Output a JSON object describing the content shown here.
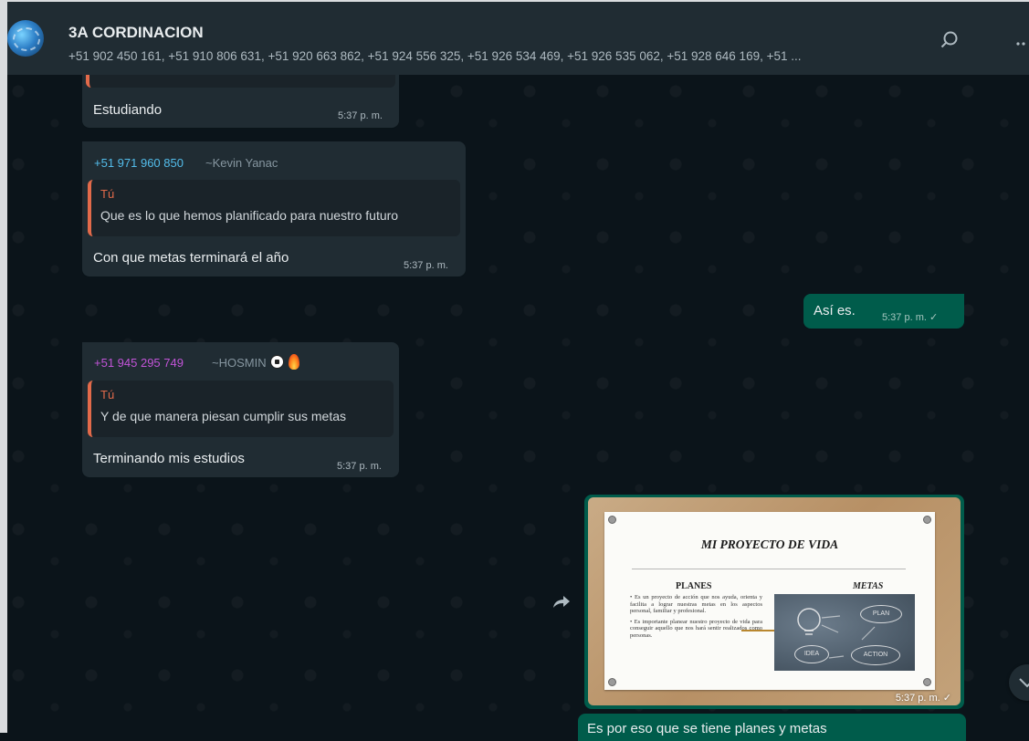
{
  "header": {
    "title": "3A CORDINACION",
    "members": "+51 902 450 161, +51 910 806 631, +51 920 663 862, +51 924 556 325, +51 926 534 469, +51 926 535 062, +51 928 646 169, +51 ...",
    "icons": [
      "search-icon",
      "menu-icon"
    ]
  },
  "messages": [
    {
      "direction": "in",
      "text": "Estudiando",
      "time": "5:37 p. m."
    },
    {
      "direction": "in",
      "sender_phone": "+51 971 960 850",
      "sender_name": "~Kevin Yanac",
      "sender_color": "#53bdeb",
      "quote_author": "Tú",
      "quote_text": "Que es lo que hemos planificado para nuestro futuro",
      "text": "Con que metas terminará el año",
      "time": "5:37 p. m."
    },
    {
      "direction": "out",
      "text": "Así es.",
      "time": "5:37 p. m. ✓"
    },
    {
      "direction": "in",
      "sender_phone": "+51 945 295 749",
      "sender_name": "~HOSMIN",
      "sender_color": "#c254d8",
      "quote_author": "Tú",
      "quote_text": "Y de que manera piesan cumplir sus metas",
      "text": "Terminando mis estudios",
      "time": "5:37 p. m."
    },
    {
      "direction": "out",
      "type": "image",
      "time": "5:37 p. m. ✓",
      "slide": {
        "title": "MI PROYECTO DE VIDA",
        "planes_heading": "PLANES",
        "metas_heading": "METAS",
        "planes_bullets": [
          "• Es un proyecto de acción que nos ayuda, orienta y facilita a lograr nuestras metas en los aspectos personal, familiar y profesional.",
          "• Es importante planear nuestro proyecto de vida para conseguir aquello que nos hará sentir realizados como personas."
        ],
        "chalk_words": [
          "PLAN",
          "IDEA",
          "ACTION"
        ]
      }
    },
    {
      "direction": "out",
      "text": "Es por eso que se tiene planes y metas"
    }
  ],
  "colors": {
    "wallpaper": "#0b141a",
    "incoming_bubble": "#202c33",
    "outgoing_bubble": "#005c4b",
    "quote_accent": "#e26a4a"
  }
}
